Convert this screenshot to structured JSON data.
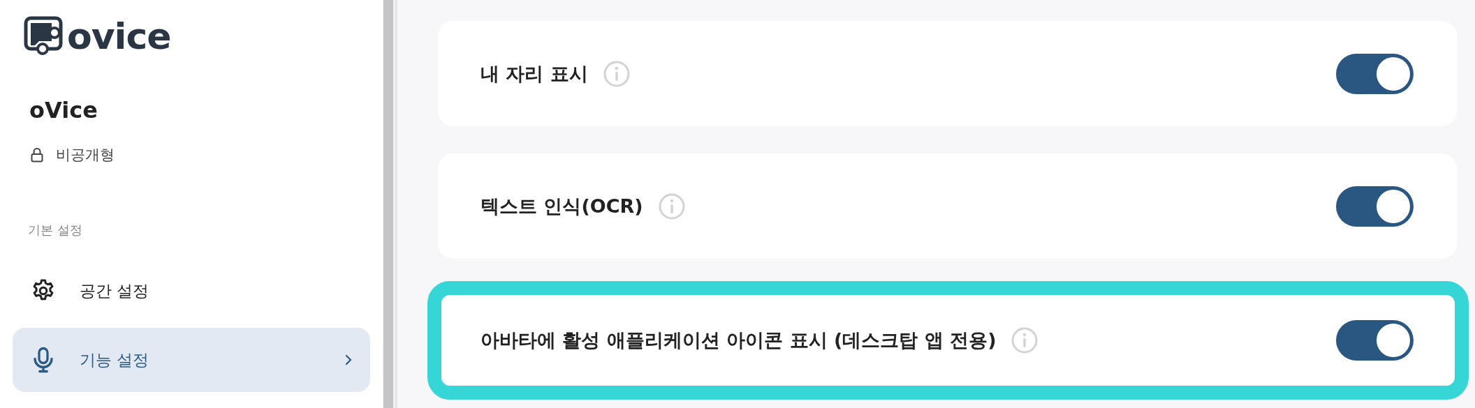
{
  "logo": {
    "text": "ovice"
  },
  "space": {
    "name": "oVice",
    "visibility": "비공개형"
  },
  "sidebar": {
    "section_label": "기본 설정",
    "items": [
      {
        "label": "공간 설정",
        "selected": false
      },
      {
        "label": "기능 설정",
        "selected": true
      }
    ]
  },
  "settings": [
    {
      "label": "내 자리 표시",
      "on": true,
      "highlighted": false
    },
    {
      "label": "텍스트 인식(OCR)",
      "on": true,
      "highlighted": false
    },
    {
      "label": "아바타에 활성 애플리케이션 아이콘 표시 (데스크탑 앱 전용)",
      "on": true,
      "highlighted": true
    }
  ]
}
